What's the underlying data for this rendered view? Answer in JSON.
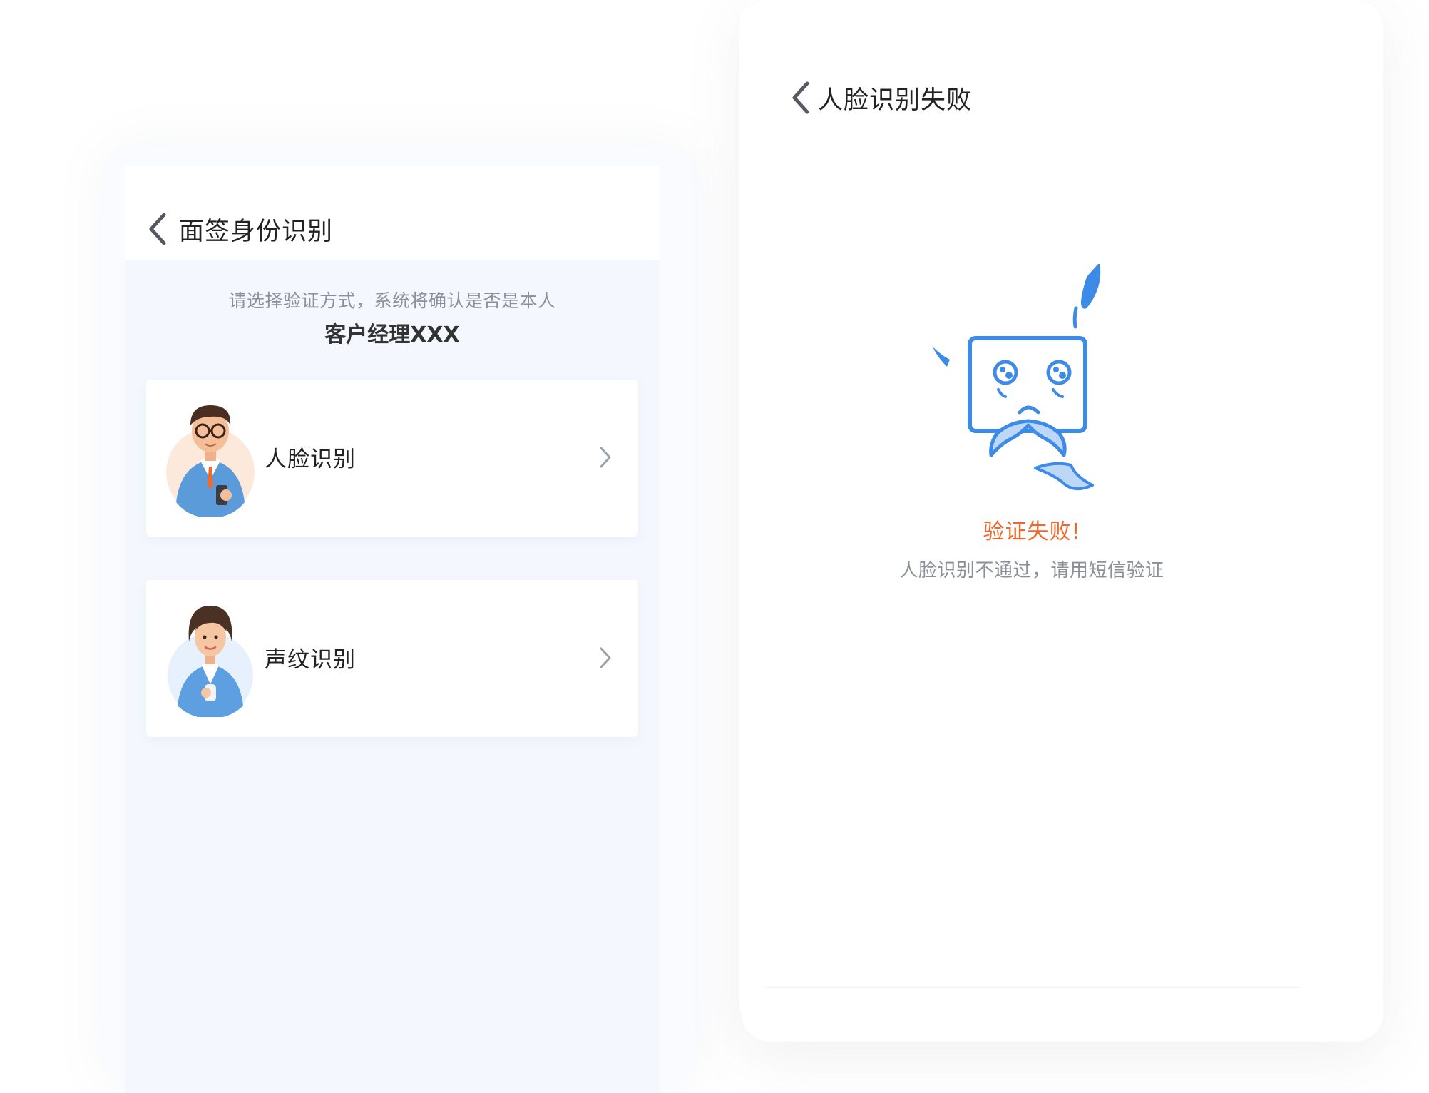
{
  "left_screen": {
    "title": "面签身份识别",
    "prompt": "请选择验证方式，系统将确认是否是本人",
    "manager_name": "客户经理XXX",
    "options": [
      {
        "label": "人脸识别",
        "icon": "male-manager-avatar"
      },
      {
        "label": "声纹识别",
        "icon": "female-manager-avatar"
      }
    ]
  },
  "right_screen": {
    "title": "人脸识别失败",
    "status_title": "验证失败!",
    "status_description": "人脸识别不通过，请用短信验证",
    "illustration": "crying-face-icon"
  },
  "colors": {
    "accent_blue": "#3d8ae8",
    "error_orange": "#f2662c",
    "page_bg": "#f4f7fd"
  }
}
